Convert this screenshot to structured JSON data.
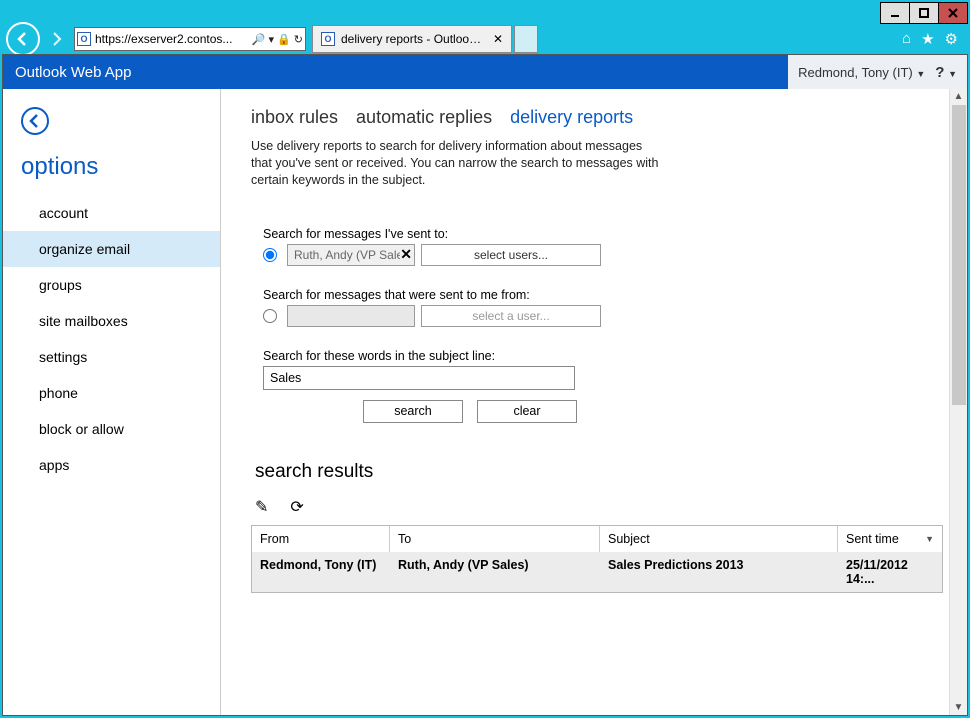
{
  "browser": {
    "url": "https://exserver2.contos...",
    "tab_title": "delivery reports - Outlook ..."
  },
  "header": {
    "app_title": "Outlook Web App",
    "user": "Redmond, Tony (IT)"
  },
  "sidebar": {
    "title": "options",
    "items": [
      {
        "label": "account"
      },
      {
        "label": "organize email"
      },
      {
        "label": "groups"
      },
      {
        "label": "site mailboxes"
      },
      {
        "label": "settings"
      },
      {
        "label": "phone"
      },
      {
        "label": "block or allow"
      },
      {
        "label": "apps"
      }
    ]
  },
  "tabs": {
    "inbox": "inbox rules",
    "auto": "automatic replies",
    "delivery": "delivery reports"
  },
  "description": "Use delivery reports to search for delivery information about messages that you've sent or received. You can narrow the search to messages with certain keywords in the subject.",
  "form": {
    "sent_to_label": "Search for messages I've sent to:",
    "sent_to_value": "Ruth, Andy (VP Sales)",
    "select_users": "select users...",
    "sent_from_label": "Search for messages that were sent to me from:",
    "select_a_user": "select a user...",
    "subject_label": "Search for these words in the subject line:",
    "subject_value": "Sales",
    "search_btn": "search",
    "clear_btn": "clear"
  },
  "results": {
    "title": "search results",
    "headers": {
      "from": "From",
      "to": "To",
      "subject": "Subject",
      "time": "Sent time"
    },
    "rows": [
      {
        "from": "Redmond, Tony (IT)",
        "to": "Ruth, Andy (VP Sales)",
        "subject": "Sales Predictions 2013",
        "time": "25/11/2012 14:..."
      }
    ]
  }
}
